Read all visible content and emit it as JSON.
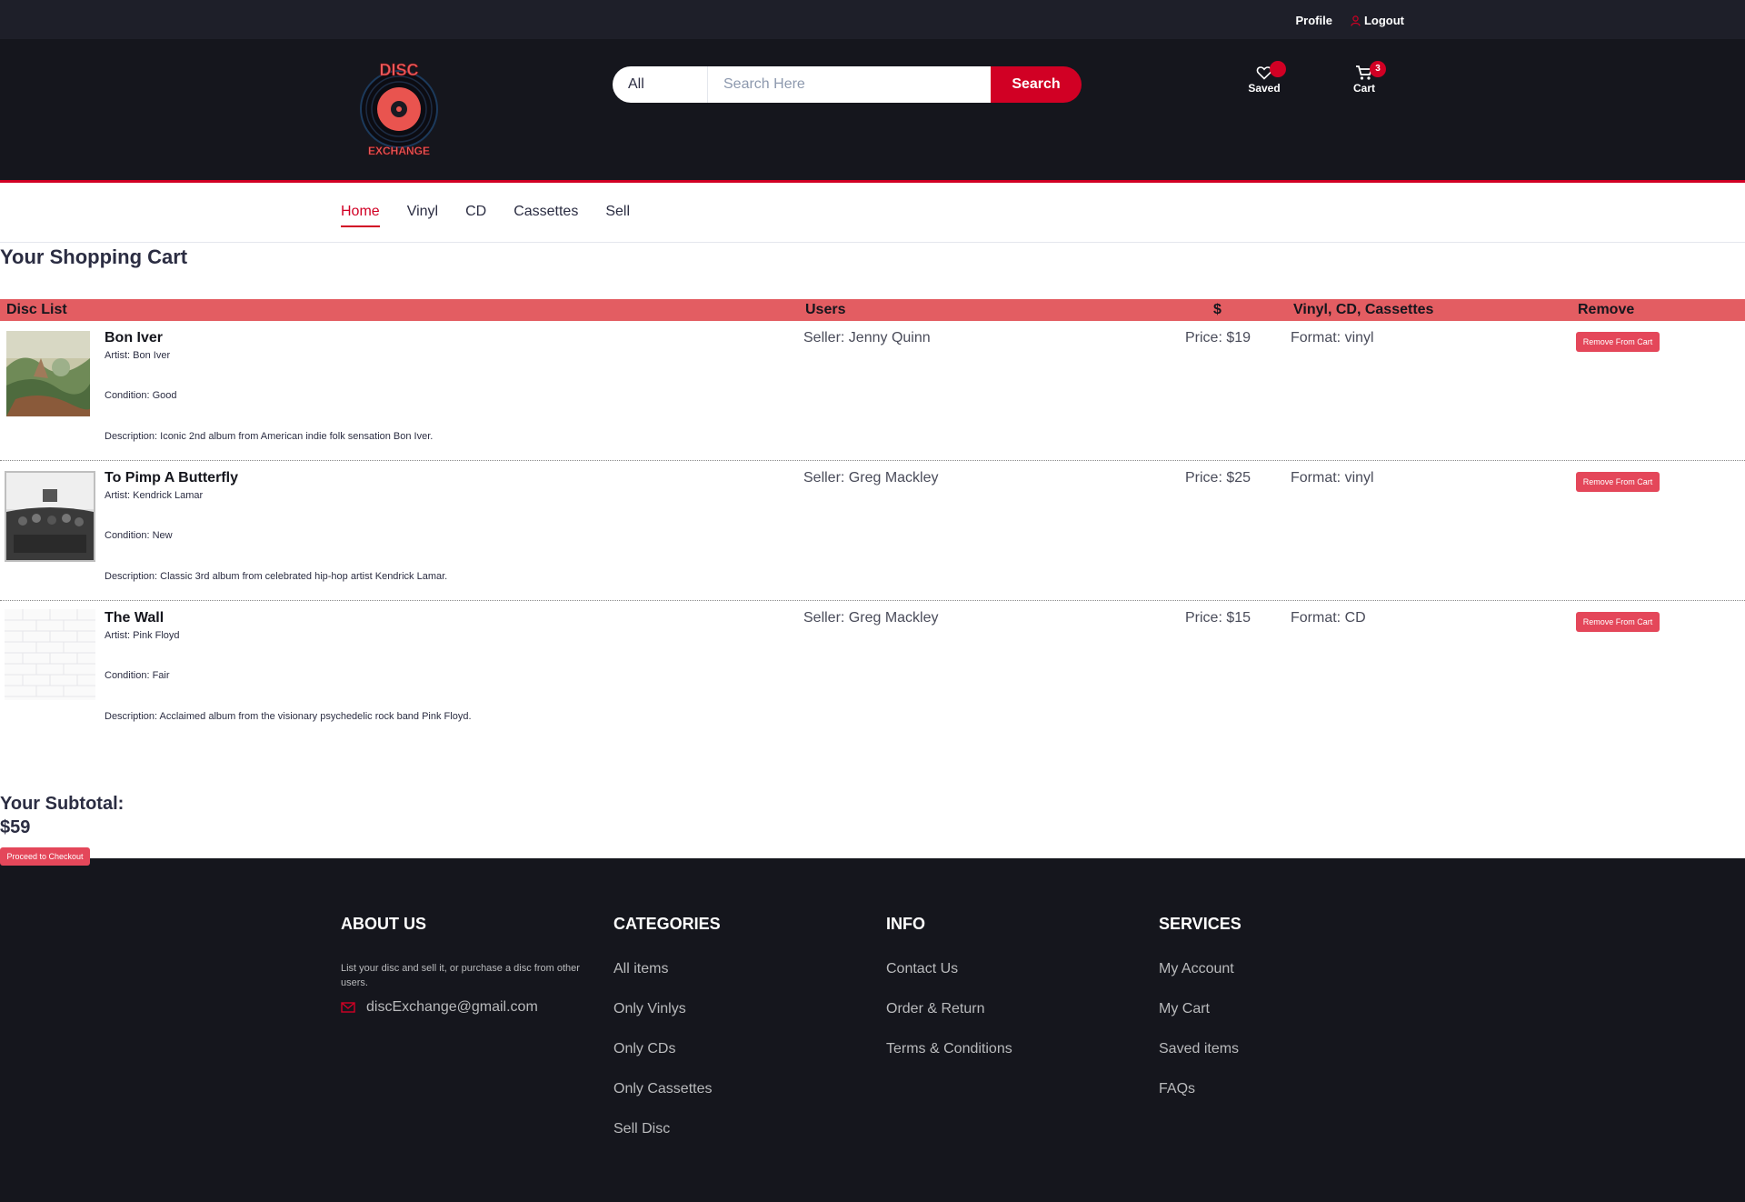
{
  "topbar": {
    "profile": "Profile",
    "logout": "Logout"
  },
  "brand": {
    "logo_top": "DISC",
    "logo_bottom": "EXCHANGE"
  },
  "search": {
    "category": "All",
    "placeholder": "Search Here",
    "button": "Search"
  },
  "header_actions": {
    "saved_label": "Saved",
    "cart_label": "Cart",
    "cart_count": "3"
  },
  "nav": {
    "items": [
      "Home",
      "Vinyl",
      "CD",
      "Cassettes",
      "Sell"
    ],
    "active": "Home"
  },
  "cart": {
    "title": "Your Shopping Cart",
    "columns": {
      "list": "Disc List",
      "users": "Users",
      "price": "$",
      "format": "Vinyl, CD, Cassettes",
      "remove": "Remove"
    },
    "items": [
      {
        "title": "Bon Iver",
        "artist": "Artist: Bon Iver",
        "condition": "Condition: Good",
        "description": "Description: Iconic 2nd album from American indie folk sensation Bon Iver.",
        "seller": "Seller: Jenny Quinn",
        "price": "Price: $19",
        "format": "Format: vinyl",
        "remove": "Remove From Cart"
      },
      {
        "title": "To Pimp A Butterfly",
        "artist": "Artist: Kendrick Lamar",
        "condition": "Condition: New",
        "description": "Description: Classic 3rd album from celebrated hip-hop artist Kendrick Lamar.",
        "seller": "Seller: Greg Mackley",
        "price": "Price: $25",
        "format": "Format: vinyl",
        "remove": "Remove From Cart"
      },
      {
        "title": "The Wall",
        "artist": "Artist: Pink Floyd",
        "condition": "Condition: Fair",
        "description": "Description: Acclaimed album from the visionary psychedelic rock band Pink Floyd.",
        "seller": "Seller: Greg Mackley",
        "price": "Price: $15",
        "format": "Format: CD",
        "remove": "Remove From Cart"
      }
    ],
    "subtotal_label": "Your Subtotal:",
    "subtotal_value": "$59",
    "checkout": "Proceed to Checkout"
  },
  "footer": {
    "about": {
      "heading": "ABOUT US",
      "text": "List your disc and sell it, or purchase a disc from other users.",
      "email": "discExchange@gmail.com"
    },
    "categories": {
      "heading": "CATEGORIES",
      "links": [
        "All items",
        "Only Vinlys",
        "Only CDs",
        "Only Cassettes",
        "Sell Disc"
      ]
    },
    "info": {
      "heading": "INFO",
      "links": [
        "Contact Us",
        "Order & Return",
        "Terms & Conditions"
      ]
    },
    "services": {
      "heading": "SERVICES",
      "links": [
        "My Account",
        "My Cart",
        "Saved items",
        "FAQs"
      ]
    }
  },
  "colors": {
    "accent": "#d10024",
    "header_bg": "#15161d",
    "table_header": "#e35d62",
    "button": "#e4475a"
  }
}
